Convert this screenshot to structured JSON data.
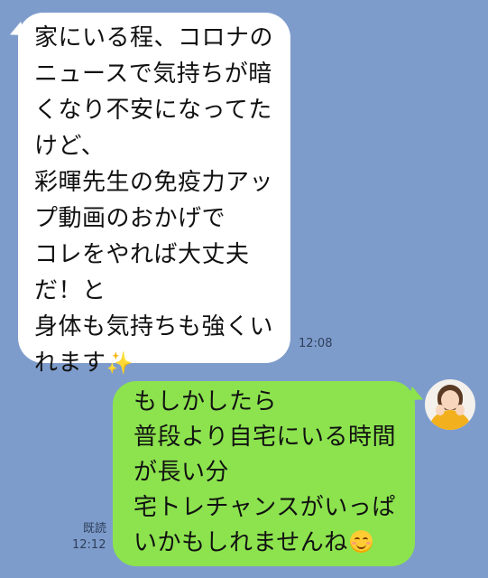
{
  "messages": {
    "incoming": {
      "lines": [
        "家にいる程、コロナの",
        "ニュースで気持ちが暗",
        "くなり不安になってた",
        "けど、",
        "彩暉先生の免疫力アッ",
        "プ動画のおかげで",
        "コレをやれば大丈夫",
        "だ！と",
        "身体も気持ちも強くい",
        "れます"
      ],
      "sparkle": "✨",
      "time": "12:08"
    },
    "outgoing": {
      "lines": [
        "もしかしたら",
        "普段より自宅にいる時間",
        "が長い分",
        "宅トレチャンスがいっぱ",
        "いかもしれませんね"
      ],
      "emoji_icon": "smiling-face-emoji",
      "read_status": "既読",
      "time": "12:12"
    }
  },
  "colors": {
    "background": "#7e9ccb",
    "incoming_bubble": "#ffffff",
    "outgoing_bubble": "#8ce34e",
    "meta_text": "#2e3f5c"
  },
  "icons": {
    "avatar": "user-avatar"
  }
}
